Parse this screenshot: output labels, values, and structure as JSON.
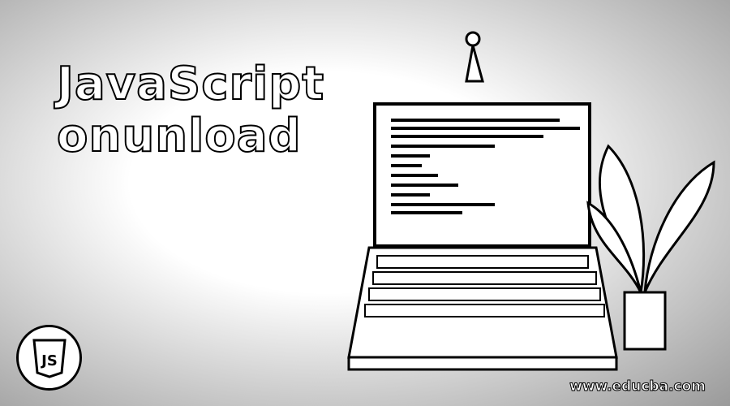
{
  "banner": {
    "title_line1": "JavaScript",
    "title_line2": "onunload",
    "watermark": "www.educba.com",
    "logo_text": "JS"
  }
}
